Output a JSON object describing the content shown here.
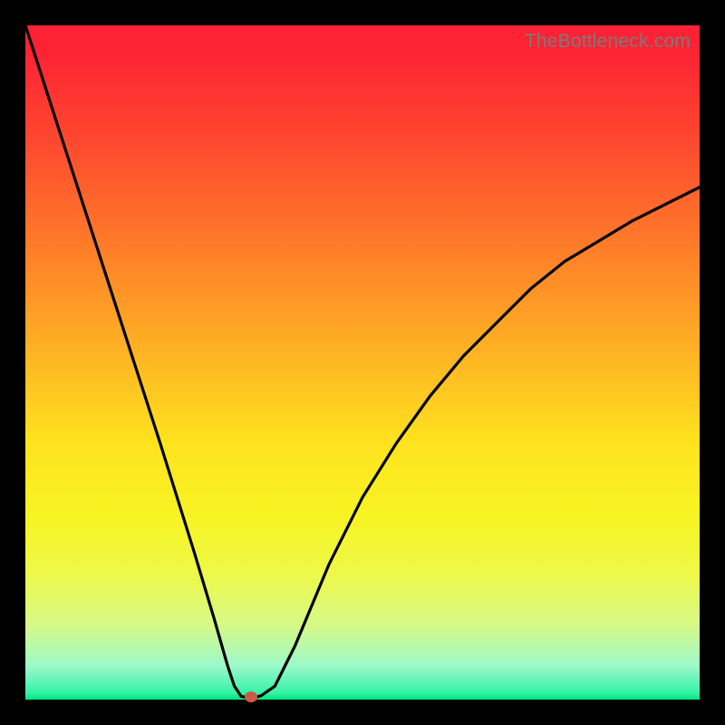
{
  "watermark": "TheBottleneck.com",
  "chart_data": {
    "type": "line",
    "title": "",
    "xlabel": "",
    "ylabel": "",
    "xlim": [
      0,
      100
    ],
    "ylim": [
      0,
      100
    ],
    "grid": false,
    "series": [
      {
        "name": "bottleneck-curve",
        "x": [
          0,
          10,
          20,
          25,
          28,
          30,
          31,
          32,
          33,
          34,
          35,
          37,
          40,
          45,
          50,
          55,
          60,
          65,
          70,
          75,
          80,
          85,
          90,
          95,
          100
        ],
        "y": [
          100,
          69,
          38,
          22,
          12,
          5,
          2,
          0.5,
          0.3,
          0.3,
          0.6,
          2,
          8,
          20,
          30,
          38,
          45,
          51,
          56,
          61,
          65,
          68,
          71,
          73.5,
          76
        ]
      }
    ],
    "marker": {
      "x": 33.5,
      "y": 0.4,
      "name": "min-point"
    },
    "colors": {
      "curve": "#000000",
      "marker": "#cf5a46",
      "gradient_top": "#fd2334",
      "gradient_bottom": "#00e47a"
    }
  }
}
